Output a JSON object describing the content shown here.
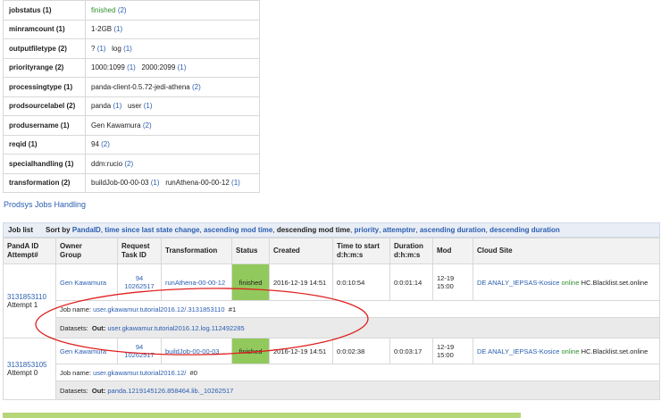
{
  "attributes": [
    {
      "key": "jobstatus (1)",
      "values": [
        {
          "text": "finished",
          "count": "(2)",
          "green": true
        }
      ]
    },
    {
      "key": "minramcount (1)",
      "values": [
        {
          "text": "1-2GB",
          "count": "(1)"
        }
      ]
    },
    {
      "key": "outputfiletype (2)",
      "values": [
        {
          "text": "?",
          "count": "(1)"
        },
        {
          "text": "log",
          "count": "(1)"
        }
      ]
    },
    {
      "key": "priorityrange (2)",
      "values": [
        {
          "text": "1000:1099",
          "count": "(1)"
        },
        {
          "text": "2000:2099",
          "count": "(1)"
        }
      ]
    },
    {
      "key": "processingtype (1)",
      "values": [
        {
          "text": "panda-client-0.5.72-jedi-athena",
          "count": "(2)"
        }
      ]
    },
    {
      "key": "prodsourcelabel (2)",
      "values": [
        {
          "text": "panda",
          "count": "(1)"
        },
        {
          "text": "user",
          "count": "(1)"
        }
      ]
    },
    {
      "key": "produsername (1)",
      "values": [
        {
          "text": "Gen Kawamura",
          "count": "(2)"
        }
      ]
    },
    {
      "key": "reqid (1)",
      "values": [
        {
          "text": "94",
          "count": "(2)"
        }
      ]
    },
    {
      "key": "specialhandling (1)",
      "values": [
        {
          "text": "ddm:rucio",
          "count": "(2)"
        }
      ]
    },
    {
      "key": "transformation (2)",
      "values": [
        {
          "text": "buildJob-00-00-03",
          "count": "(1)"
        },
        {
          "text": "runAthena-00-00-12",
          "count": "(1)"
        }
      ]
    }
  ],
  "prodsys_link": "Prodsys Jobs Handling",
  "joblist": {
    "title": "Job list",
    "sort_prefix": "Sort by",
    "sort_options": [
      "PandaID",
      "time since last state change",
      "ascending mod time"
    ],
    "sort_current": "descending mod time",
    "sort_options2": [
      "priority",
      "attemptnr",
      "ascending duration",
      "descending duration"
    ],
    "columns": {
      "pandaid": "PandA ID",
      "attempt": "Attempt#",
      "owner": "Owner",
      "group": "Group",
      "request": "Request",
      "taskid": "Task ID",
      "transformation": "Transformation",
      "status": "Status",
      "created": "Created",
      "tts1": "Time to start",
      "tts2": "d:h:m:s",
      "dur1": "Duration",
      "dur2": "d:h:m:s",
      "mod": "Mod",
      "cloud": "Cloud Site"
    },
    "jobs": [
      {
        "pandaid": "3131853110",
        "attempt": "Attempt 1",
        "owner": "Gen Kawamura",
        "request": "94",
        "taskid": "10262517",
        "transformation": "runAthena-00-00-12",
        "status": "finished",
        "created": "2016-12-19 14:51",
        "tts": "0:0:10:54",
        "duration": "0:0:01:14",
        "mod": "12-19 15:00",
        "site": "DE ANALY_IEPSAS-Kosice",
        "site_state": "online",
        "site_extra": "HC.Blacklist.set.online",
        "jobname_label": "Job name:",
        "jobname": "user.gkawamur.tutorial2016.12/.3131853110",
        "jobname_suffix": "#1",
        "datasets_label": "Datasets:",
        "out_label": "Out:",
        "out": "user.gkawamur.tutorial2016.12.log.112492285"
      },
      {
        "pandaid": "3131853105",
        "attempt": "Attempt 0",
        "owner": "Gen Kawamura",
        "request": "94",
        "taskid": "10262517",
        "transformation": "buildJob-00-00-03",
        "status": "finished",
        "created": "2016-12-19 14:51",
        "tts": "0:0:02:38",
        "duration": "0:0:03:17",
        "mod": "12-19 15:00",
        "site": "DE ANALY_IEPSAS-Kosice",
        "site_state": "online",
        "site_extra": "HC.Blacklist.set.online",
        "jobname_label": "Job name:",
        "jobname": "user.gkawamur.tutorial2016.12/",
        "jobname_suffix": "#0",
        "datasets_label": "Datasets:",
        "out_label": "Out:",
        "out": "panda.1219145126.858464.lib._10262517"
      }
    ]
  },
  "colors": {
    "status_finished": "#92c95c",
    "link": "#2a5db0",
    "online": "#2f8f2f",
    "annotation_oval": "#e02020"
  }
}
